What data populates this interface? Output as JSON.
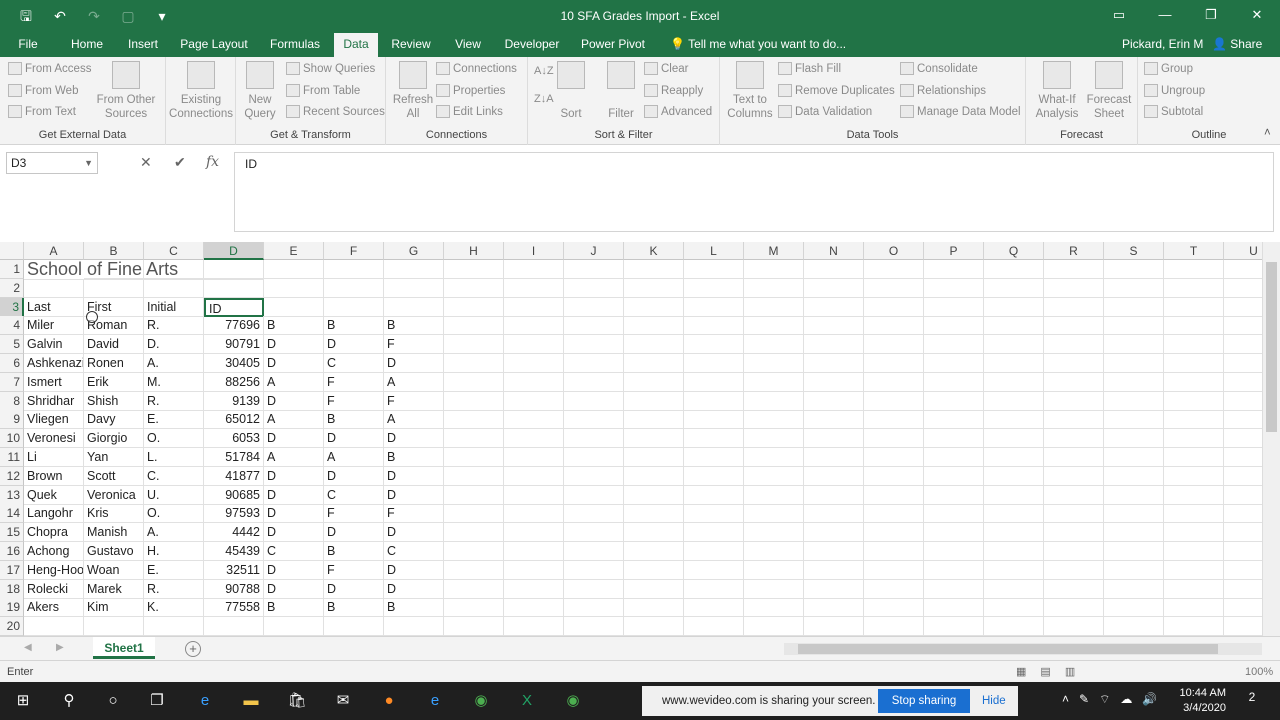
{
  "window": {
    "title": "10 SFA Grades Import - Excel",
    "minimize": "—",
    "restore": "❐",
    "close": "✕"
  },
  "tabs": [
    "File",
    "Home",
    "Insert",
    "Page Layout",
    "Formulas",
    "Data",
    "Review",
    "View",
    "Developer",
    "Power Pivot"
  ],
  "active_tab": "Data",
  "tell_me": "Tell me what you want to do...",
  "user": "Pickard, Erin M",
  "share": "Share",
  "ribbon": {
    "get_external": {
      "label": "Get External Data",
      "from_access": "From Access",
      "from_web": "From Web",
      "from_text": "From Text",
      "from_other": "From Other",
      "from_other2": "Sources",
      "existing": "Existing",
      "existing2": "Connections"
    },
    "get_transform": {
      "label": "Get & Transform",
      "new_query": "New",
      "new_query2": "Query",
      "show_queries": "Show Queries",
      "from_table": "From Table",
      "recent_sources": "Recent Sources"
    },
    "connections": {
      "label": "Connections",
      "refresh": "Refresh",
      "refresh2": "All",
      "connections": "Connections",
      "properties": "Properties",
      "edit_links": "Edit Links"
    },
    "sort_filter": {
      "label": "Sort & Filter",
      "sort": "Sort",
      "filter": "Filter",
      "clear": "Clear",
      "reapply": "Reapply",
      "advanced": "Advanced"
    },
    "data_tools": {
      "label": "Data Tools",
      "text_to": "Text to",
      "text_to2": "Columns",
      "flash_fill": "Flash Fill",
      "remove_dup": "Remove Duplicates",
      "validation": "Data Validation",
      "consolidate": "Consolidate",
      "relationships": "Relationships",
      "manage_model": "Manage Data Model"
    },
    "forecast": {
      "label": "Forecast",
      "whatif": "What-If",
      "whatif2": "Analysis",
      "sheet": "Forecast",
      "sheet2": "Sheet"
    },
    "outline": {
      "label": "Outline",
      "group": "Group",
      "ungroup": "Ungroup",
      "subtotal": "Subtotal"
    }
  },
  "formula_bar": {
    "name_box": "D3",
    "cancel": "✕",
    "enter": "✔",
    "fx": "fx",
    "content": "ID"
  },
  "columns": [
    "A",
    "B",
    "C",
    "D",
    "E",
    "F",
    "G",
    "H",
    "I",
    "J",
    "K",
    "L",
    "M",
    "N",
    "O",
    "P",
    "Q",
    "R",
    "S",
    "T",
    "U"
  ],
  "sheet_title": "School of Fine Arts",
  "headers": [
    "Last",
    "First",
    "Initial",
    "ID"
  ],
  "rows": [
    [
      "Miler",
      "Roman",
      "R.",
      "77696",
      "B",
      "B",
      "B"
    ],
    [
      "Galvin",
      "David",
      "D.",
      "90791",
      "D",
      "D",
      "F"
    ],
    [
      "Ashkenazi",
      "Ronen",
      "A.",
      "30405",
      "D",
      "C",
      "D"
    ],
    [
      "Ismert",
      "Erik",
      "M.",
      "88256",
      "A",
      "F",
      "A"
    ],
    [
      "Shridhar",
      "Shish",
      "R.",
      "9139",
      "D",
      "F",
      "F"
    ],
    [
      "Vliegen",
      "Davy",
      "E.",
      "65012",
      "A",
      "B",
      "A"
    ],
    [
      "Veronesi",
      "Giorgio",
      "O.",
      "6053",
      "D",
      "D",
      "D"
    ],
    [
      "Li",
      "Yan",
      "L.",
      "51784",
      "A",
      "A",
      "B"
    ],
    [
      "Brown",
      "Scott",
      "C.",
      "41877",
      "D",
      "D",
      "D"
    ],
    [
      "Quek",
      "Veronica",
      "U.",
      "90685",
      "D",
      "C",
      "D"
    ],
    [
      "Langohr",
      "Kris",
      "O.",
      "97593",
      "D",
      "F",
      "F"
    ],
    [
      "Chopra",
      "Manish",
      "A.",
      "4442",
      "D",
      "D",
      "D"
    ],
    [
      "Achong",
      "Gustavo",
      "H.",
      "45439",
      "C",
      "B",
      "C"
    ],
    [
      "Heng-Hoo",
      "Woan",
      "E.",
      "32511",
      "D",
      "F",
      "D"
    ],
    [
      "Rolecki",
      "Marek",
      "R.",
      "90788",
      "D",
      "D",
      "D"
    ],
    [
      "Akers",
      "Kim",
      "K.",
      "77558",
      "B",
      "B",
      "B"
    ]
  ],
  "sheet_tab": "Sheet1",
  "add_sheet": "+",
  "status_mode": "Enter",
  "zoom": "100%",
  "taskbar": {
    "share_msg": "www.wevideo.com is sharing your screen.",
    "stop_sharing": "Stop sharing",
    "hide": "Hide",
    "time": "10:44 AM",
    "date": "3/4/2020",
    "notif": "2"
  }
}
